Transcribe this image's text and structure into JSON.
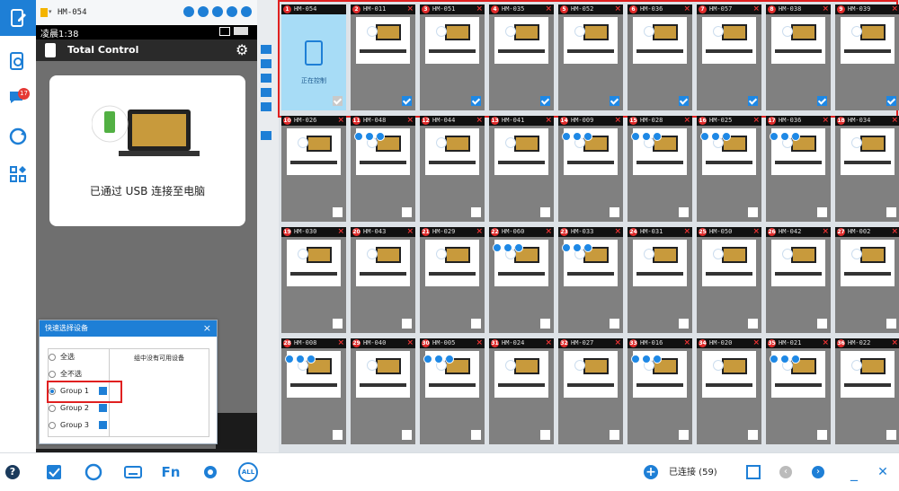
{
  "left_toolbar": {
    "badge_count": "17"
  },
  "device_header": {
    "name": "HM-054"
  },
  "phone": {
    "status_time": "凌晨1:38",
    "app_title": "Total Control",
    "usb_message": "已通过 USB 连接至电脑"
  },
  "quick_select": {
    "title": "快速选择设备",
    "close": "×",
    "select_all": "全选",
    "select_none": "全不选",
    "groups": [
      "Group 1",
      "Group 2",
      "Group 3"
    ],
    "selected_group": "Group 1",
    "empty_message": "组中没有可用设备"
  },
  "devices": [
    {
      "num": "1",
      "name": "HM-054",
      "checked": true,
      "active": true,
      "status": "正在控制",
      "controls": false
    },
    {
      "num": "2",
      "name": "HM-011",
      "checked": true,
      "controls": false
    },
    {
      "num": "3",
      "name": "HM-051",
      "checked": true,
      "controls": false
    },
    {
      "num": "4",
      "name": "HM-035",
      "checked": true,
      "controls": false
    },
    {
      "num": "5",
      "name": "HM-052",
      "checked": true,
      "controls": false
    },
    {
      "num": "6",
      "name": "HM-036",
      "checked": true,
      "controls": false
    },
    {
      "num": "7",
      "name": "HM-057",
      "checked": true,
      "controls": false
    },
    {
      "num": "8",
      "name": "HM-038",
      "checked": true,
      "controls": false
    },
    {
      "num": "9",
      "name": "HM-039",
      "checked": true,
      "controls": false
    },
    {
      "num": "10",
      "name": "HM-026",
      "checked": false,
      "controls": false
    },
    {
      "num": "11",
      "name": "HM-048",
      "checked": false,
      "controls": true
    },
    {
      "num": "12",
      "name": "HM-044",
      "checked": false,
      "controls": false
    },
    {
      "num": "13",
      "name": "HM-041",
      "checked": false,
      "controls": false
    },
    {
      "num": "14",
      "name": "HM-009",
      "checked": false,
      "controls": true
    },
    {
      "num": "15",
      "name": "HM-028",
      "checked": false,
      "controls": true
    },
    {
      "num": "16",
      "name": "HM-025",
      "checked": false,
      "controls": true
    },
    {
      "num": "17",
      "name": "HM-036",
      "checked": false,
      "controls": true
    },
    {
      "num": "18",
      "name": "HM-034",
      "checked": false,
      "controls": false
    },
    {
      "num": "19",
      "name": "HM-030",
      "checked": false,
      "controls": false
    },
    {
      "num": "20",
      "name": "HM-043",
      "checked": false,
      "controls": false
    },
    {
      "num": "21",
      "name": "HM-029",
      "checked": false,
      "controls": false
    },
    {
      "num": "22",
      "name": "HM-060",
      "checked": false,
      "controls": true
    },
    {
      "num": "23",
      "name": "HM-033",
      "checked": false,
      "controls": true
    },
    {
      "num": "24",
      "name": "HM-031",
      "checked": false,
      "controls": false
    },
    {
      "num": "25",
      "name": "HM-050",
      "checked": false,
      "controls": false
    },
    {
      "num": "26",
      "name": "HM-042",
      "checked": false,
      "controls": false
    },
    {
      "num": "27",
      "name": "HM-002",
      "checked": false,
      "controls": false
    },
    {
      "num": "28",
      "name": "HM-008",
      "checked": false,
      "controls": true
    },
    {
      "num": "29",
      "name": "HM-040",
      "checked": false,
      "controls": false
    },
    {
      "num": "30",
      "name": "HM-005",
      "checked": false,
      "controls": true
    },
    {
      "num": "31",
      "name": "HM-024",
      "checked": false,
      "controls": false
    },
    {
      "num": "32",
      "name": "HM-027",
      "checked": false,
      "controls": false
    },
    {
      "num": "33",
      "name": "HM-016",
      "checked": false,
      "controls": true
    },
    {
      "num": "34",
      "name": "HM-020",
      "checked": false,
      "controls": false
    },
    {
      "num": "35",
      "name": "HM-021",
      "checked": false,
      "controls": true
    },
    {
      "num": "36",
      "name": "HM-022",
      "checked": false,
      "controls": false
    }
  ],
  "bottom_bar": {
    "fn_label": "Fn",
    "all_label": "ALL",
    "help": "?",
    "connected_label": "已连接 (59)"
  },
  "colors": {
    "accent": "#1e7fd6",
    "highlight": "#e02020"
  }
}
